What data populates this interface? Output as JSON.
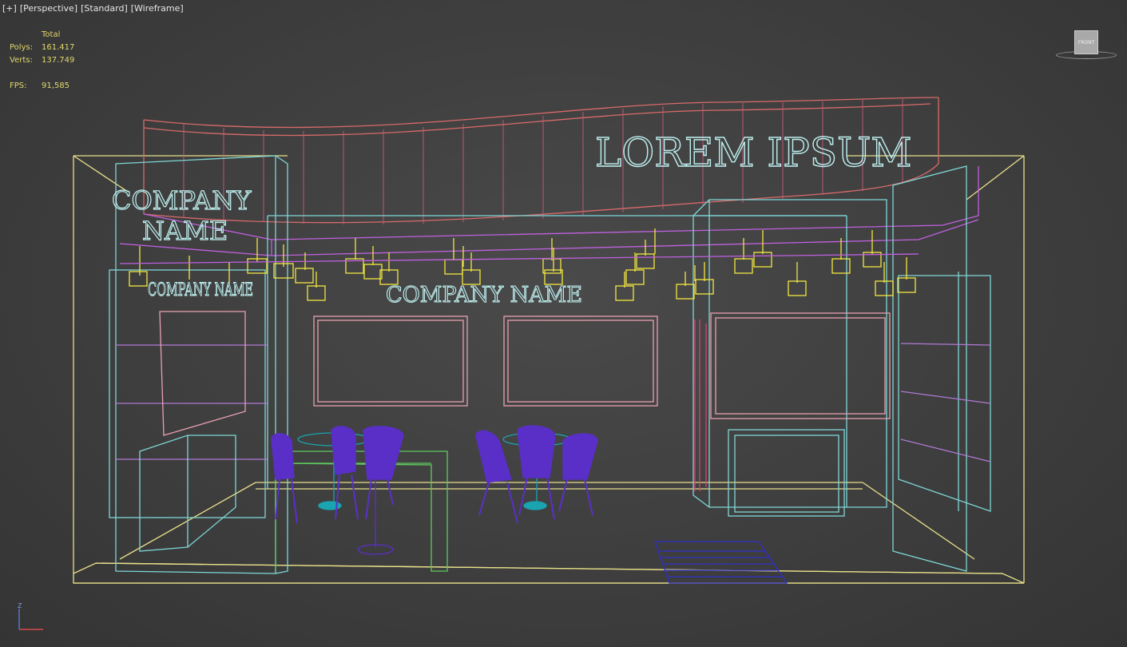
{
  "viewport_labels": [
    "[+]",
    "[Perspective]",
    "[Standard]",
    "[Wireframe]"
  ],
  "stats": {
    "header": "Total",
    "polys_label": "Polys:",
    "polys_value": "161.417",
    "verts_label": "Verts:",
    "verts_value": "137.749",
    "fps_label": "FPS:",
    "fps_value": "91,585"
  },
  "viewcube": {
    "face_label": "FRONT"
  },
  "scene": {
    "header_sign_text": "LOREM IPSUM",
    "left_tower_text_line1": "COMPANY",
    "left_tower_text_line2": "NAME",
    "left_panel_text": "COMPANY NAME",
    "back_wall_text": "COMPANY NAME"
  },
  "colors": {
    "frame_yellow": "#e8e08a",
    "cyan": "#7fd6d6",
    "pink": "#e8a0b0",
    "red": "#d96a6a",
    "magenta": "#c060e0",
    "purple": "#5a2fc8",
    "light_yellow": "#f2e640",
    "green": "#5ec95e",
    "blue": "#3030c8",
    "teal": "#1aa3b0"
  },
  "axis": {
    "z_label": "Z"
  }
}
